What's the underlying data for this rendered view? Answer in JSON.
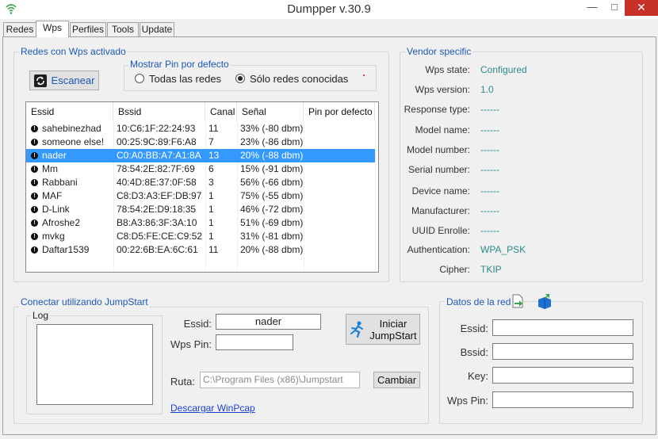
{
  "window": {
    "title": "Dumpper v.30.9",
    "minimize": "—",
    "maximize": "□",
    "close": "✕"
  },
  "tabs": [
    "Redes",
    "Wps",
    "Perfiles",
    "Tools",
    "Update"
  ],
  "wps_group": {
    "title": "Redes con Wps activado",
    "scan_button": "Escanear",
    "pin_group": {
      "title": "Mostrar Pin por defecto",
      "option_all": "Todas las redes",
      "option_known": "Sólo redes conocidas",
      "selected": "known"
    },
    "columns": [
      "Essid",
      "Bssid",
      "Canal",
      "Señal",
      "Pin por defecto"
    ],
    "rows": [
      {
        "essid": "sahebinezhad",
        "bssid": "10:C6:1F:22:24:93",
        "canal": "11",
        "senal": "33% (-80 dbm)",
        "pin": ""
      },
      {
        "essid": "someone else!",
        "bssid": "00:25:9C:89:F6:A8",
        "canal": "7",
        "senal": "23% (-86 dbm)",
        "pin": ""
      },
      {
        "essid": "nader",
        "bssid": "C0:A0:BB:A7:A1:8A",
        "canal": "13",
        "senal": "20% (-88 dbm)",
        "pin": "",
        "selected": true
      },
      {
        "essid": "Mm",
        "bssid": "78:54:2E:82:7F:69",
        "canal": "6",
        "senal": "15% (-91 dbm)",
        "pin": ""
      },
      {
        "essid": "Rabbani",
        "bssid": "40:4D:8E:37:0F:58",
        "canal": "3",
        "senal": "56% (-66 dbm)",
        "pin": ""
      },
      {
        "essid": "MAF",
        "bssid": "C8:D3:A3:EF:DB:97",
        "canal": "1",
        "senal": "75% (-55 dbm)",
        "pin": ""
      },
      {
        "essid": "D-Link",
        "bssid": "78:54:2E:D9:18:35",
        "canal": "1",
        "senal": "46% (-72 dbm)",
        "pin": ""
      },
      {
        "essid": "Afroshe2",
        "bssid": "B8:A3:86:3F:3A:10",
        "canal": "1",
        "senal": "51% (-69 dbm)",
        "pin": ""
      },
      {
        "essid": "mvkg",
        "bssid": "C8:D5:FE:CE:C9:52",
        "canal": "1",
        "senal": "31% (-81 dbm)",
        "pin": ""
      },
      {
        "essid": "Daftar1539",
        "bssid": "00:22:6B:EA:6C:61",
        "canal": "11",
        "senal": "20% (-88 dbm)",
        "pin": ""
      }
    ]
  },
  "vendor": {
    "title": "Vendor specific",
    "fields": [
      {
        "label": "Wps state:",
        "value": "Configured"
      },
      {
        "label": "Wps version:",
        "value": "1.0"
      },
      {
        "label": "Response type:",
        "value": "------"
      },
      {
        "label": "Model name:",
        "value": "------"
      },
      {
        "label": "Model number:",
        "value": "------"
      },
      {
        "label": "Serial number:",
        "value": "------"
      },
      {
        "label": "Device name:",
        "value": "------"
      },
      {
        "label": "Manufacturer:",
        "value": "------"
      },
      {
        "label": "UUID Enrolle:",
        "value": "------"
      },
      {
        "label": "Authentication:",
        "value": "WPA_PSK"
      },
      {
        "label": "Cipher:",
        "value": "TKIP"
      }
    ]
  },
  "jumpstart": {
    "title": "Conectar utilizando JumpStart",
    "log_title": "Log",
    "essid_label": "Essid:",
    "essid_value": "nader",
    "wpspin_label": "Wps Pin:",
    "wpspin_value": "",
    "start_button_line1": "Iniciar",
    "start_button_line2": "JumpStart",
    "ruta_label": "Ruta:",
    "ruta_value": "C:\\Program Files (x86)\\Jumpstart",
    "change_button": "Cambiar",
    "download_link": "Descargar WinPcap"
  },
  "network_data": {
    "title": "Datos de la red",
    "essid_label": "Essid:",
    "bssid_label": "Bssid:",
    "key_label": "Key:",
    "wpspin_label": "Wps Pin:",
    "essid_value": "",
    "bssid_value": "",
    "key_value": "",
    "wpspin_value": ""
  },
  "colors": {
    "accent": "#1c58b8",
    "selection": "#3399ff",
    "value": "#2b8a8a",
    "close": "#c7312a"
  }
}
